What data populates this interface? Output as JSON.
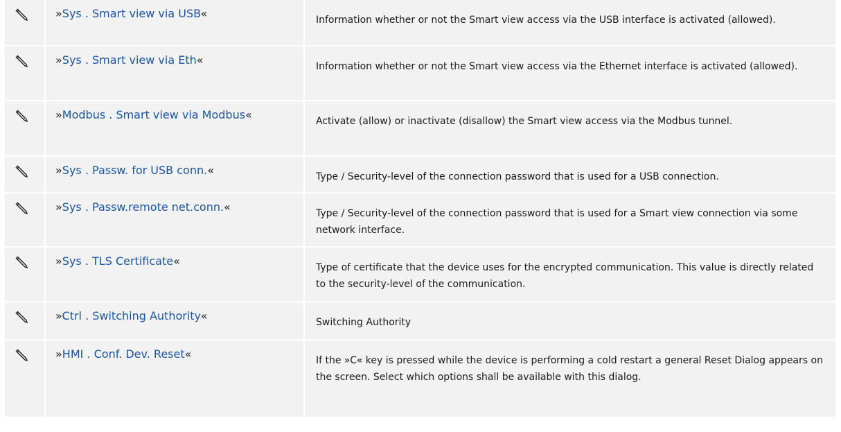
{
  "rows": [
    {
      "prefix": "»",
      "name": "Sys . Smart view via USB",
      "suffix": "«",
      "description": "Information whether or not the Smart view access via the USB interface is activated (allowed).",
      "icon": "pencil-icon"
    },
    {
      "prefix": "»",
      "name": "Sys . Smart view via Eth",
      "suffix": "«",
      "description": "Information whether or not the Smart view access via the Ethernet interface is activated (allowed).",
      "icon": "pencil-icon"
    },
    {
      "prefix": "»",
      "name": "Modbus . Smart view via Modbus",
      "suffix": "«",
      "description": "Activate (allow) or inactivate (disallow) the Smart view access via the Modbus tunnel.",
      "icon": "pencil-icon"
    },
    {
      "prefix": "»",
      "name": "Sys . Passw. for USB conn.",
      "suffix": "«",
      "description": "Type / Security-level of the connection password that is used for a USB connection.",
      "icon": "pencil-icon"
    },
    {
      "prefix": "»",
      "name": "Sys . Passw.remote net.conn.",
      "suffix": "«",
      "description": "Type / Security-level of the connection password that is used for a Smart view connection via some network interface.",
      "icon": "pencil-icon"
    },
    {
      "prefix": "»",
      "name": "Sys . TLS Certificate",
      "suffix": "«",
      "description": "Type of certificate that the device uses for the encrypted communication. This value is directly related to the security-level of the communication.",
      "icon": "pencil-icon"
    },
    {
      "prefix": "»",
      "name": "Ctrl . Switching Authority",
      "suffix": "«",
      "description": "Switching Authority",
      "icon": "pencil-icon"
    },
    {
      "prefix": "»",
      "name": "HMI . Conf. Dev. Reset",
      "suffix": "«",
      "description": "If the »C« key is pressed while the device is performing a cold restart a general Reset Dialog appears on the screen. Select which options shall be available with this dialog.",
      "icon": "pencil-icon"
    }
  ],
  "colors": {
    "link": "#1a55a3",
    "row_bg": "#f2f2f2"
  }
}
